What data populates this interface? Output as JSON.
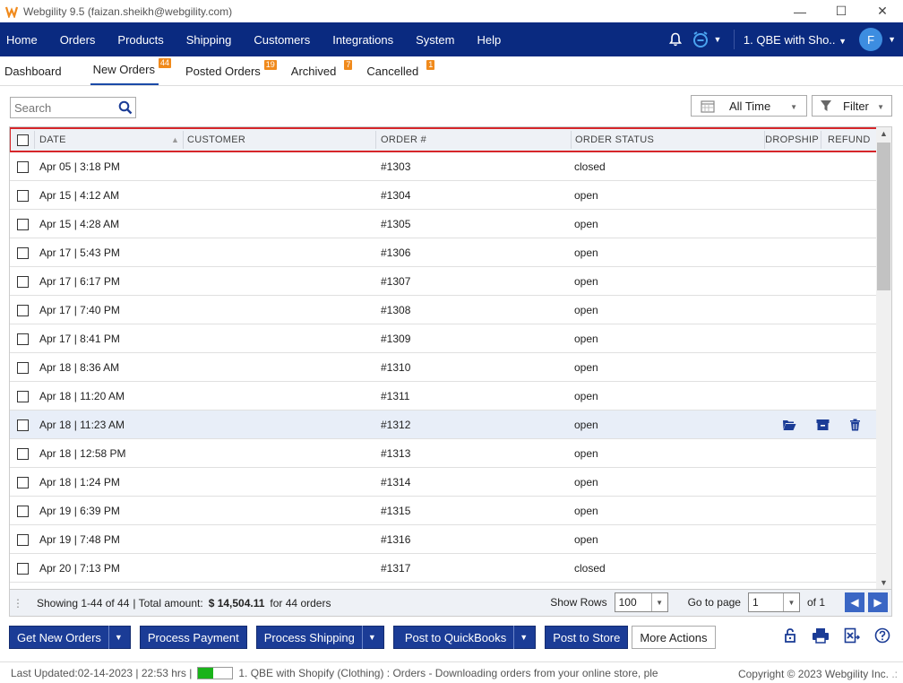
{
  "window": {
    "title": "Webgility 9.5 (faizan.sheikh@webgility.com)",
    "controls": [
      "—",
      "☐",
      "✕"
    ]
  },
  "nav": {
    "items": [
      "Home",
      "Orders",
      "Products",
      "Shipping",
      "Customers",
      "Integrations",
      "System",
      "Help"
    ],
    "store_selector": "1. QBE with Sho..",
    "avatar_initial": "F"
  },
  "tabs": [
    {
      "label": "Dashboard",
      "badge": ""
    },
    {
      "label": "New Orders",
      "badge": "44"
    },
    {
      "label": "Posted Orders",
      "badge": "19"
    },
    {
      "label": "Archived",
      "badge": "7"
    },
    {
      "label": "Cancelled",
      "badge": "1"
    }
  ],
  "toolbar": {
    "search_placeholder": "Search",
    "time_filter": "All Time",
    "filter_label": "Filter"
  },
  "grid": {
    "columns": [
      "DATE",
      "CUSTOMER",
      "ORDER #",
      "ORDER STATUS",
      "DROPSHIP",
      "REFUND"
    ],
    "rows": [
      {
        "date": "Apr 05 | 3:18 PM",
        "order": "#1303",
        "status": "closed"
      },
      {
        "date": "Apr 15 | 4:12 AM",
        "order": "#1304",
        "status": "open"
      },
      {
        "date": "Apr 15 | 4:28 AM",
        "order": "#1305",
        "status": "open"
      },
      {
        "date": "Apr 17 | 5:43 PM",
        "order": "#1306",
        "status": "open"
      },
      {
        "date": "Apr 17 | 6:17 PM",
        "order": "#1307",
        "status": "open"
      },
      {
        "date": "Apr 17 | 7:40 PM",
        "order": "#1308",
        "status": "open"
      },
      {
        "date": "Apr 17 | 8:41 PM",
        "order": "#1309",
        "status": "open"
      },
      {
        "date": "Apr 18 | 8:36 AM",
        "order": "#1310",
        "status": "open"
      },
      {
        "date": "Apr 18 | 11:20 AM",
        "order": "#1311",
        "status": "open"
      },
      {
        "date": "Apr 18 | 11:23 AM",
        "order": "#1312",
        "status": "open"
      },
      {
        "date": "Apr 18 | 12:58 PM",
        "order": "#1313",
        "status": "open"
      },
      {
        "date": "Apr 18 | 1:24 PM",
        "order": "#1314",
        "status": "open"
      },
      {
        "date": "Apr 19 | 6:39 PM",
        "order": "#1315",
        "status": "open"
      },
      {
        "date": "Apr 19 | 7:48 PM",
        "order": "#1316",
        "status": "open"
      },
      {
        "date": "Apr 20 | 7:13 PM",
        "order": "#1317",
        "status": "closed"
      }
    ]
  },
  "footer": {
    "showing": "Showing 1-44 of 44",
    "total_label": "| Total amount:",
    "total_amount": "$ 14,504.11",
    "for_orders": "for 44 orders",
    "show_rows_label": "Show Rows",
    "show_rows_value": "100",
    "go_to_page_label": "Go to page",
    "page_value": "1",
    "of_pages": "of 1"
  },
  "actions": {
    "get_new_orders": "Get New Orders",
    "process_payment": "Process Payment",
    "process_shipping": "Process Shipping",
    "post_to_quickbooks": "Post to QuickBooks",
    "post_to_store": "Post to Store",
    "more_actions": "More Actions"
  },
  "status": {
    "last_updated": "Last Updated:02-14-2023 | 22:53 hrs |",
    "progress_fraction": 0.45,
    "message": "1. QBE with Shopify (Clothing) : Orders - Downloading orders from your online store, ple",
    "copyright": "Copyright © 2023 Webgility Inc."
  }
}
